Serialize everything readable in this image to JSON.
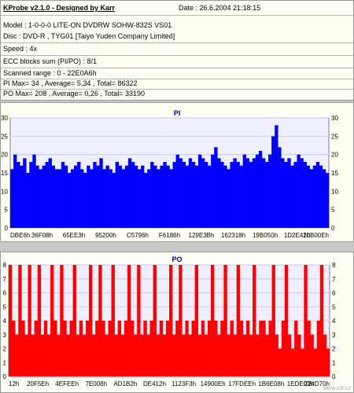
{
  "header": {
    "title": "KProbe v2.1.0 - Designed by Karr",
    "date": "Date : 26.6.2004 21:18:15",
    "model": "Model : 1-0-0-0 LITE-ON DVDRW SOHW-832S  VS01",
    "disc": "Disc : DVD-R , TYG01 [Taiyo Yuden Company Limited]",
    "speed": "Speed : 4x",
    "ecc": "ECC blocks sum (PI/PO) : 8/1",
    "range": "Scanned range : 0 - 22E0A6h",
    "pi_stats": "PI Max= 34 , Average= 5,34 , Total= 86322",
    "po_stats": "PO Max= 208 , Average= 0,26 , Total= 33190"
  },
  "watermark": "www.cdr.cz",
  "colors": {
    "pi": "#0000ff",
    "po": "#ff0000",
    "plot_bg": "#eef0ff",
    "grid": "#c8c8ff"
  },
  "chart_data": [
    {
      "type": "bar",
      "title": "PI",
      "ylim": [
        0,
        30
      ],
      "yticks": [
        "0",
        "5",
        "10",
        "15",
        "20",
        "25",
        "30"
      ],
      "xtick_labels": [
        "DBE6h",
        "36F08h",
        "65EE3h",
        "95200h",
        "C5796h",
        "F6186h",
        "129E3Bh",
        "162318h",
        "19B050h",
        "1D2E41h",
        "20B00Eh"
      ],
      "grid": true,
      "series": [
        {
          "values": [
            16,
            20,
            18,
            17,
            19,
            15,
            18,
            20,
            17,
            16,
            17,
            18,
            19,
            17,
            16,
            16,
            18,
            17,
            15,
            16,
            17,
            18,
            16,
            15,
            17,
            16,
            18,
            17,
            19,
            16,
            17,
            16,
            15,
            18,
            17,
            16,
            17,
            19,
            18,
            17,
            16,
            17,
            15,
            16,
            18,
            17,
            16,
            17,
            18,
            17,
            16,
            18,
            20,
            19,
            18,
            17,
            19,
            18,
            17,
            20,
            19,
            18,
            17,
            20,
            22,
            19,
            18,
            17,
            16,
            18,
            19,
            18,
            17,
            20,
            19,
            18,
            19,
            20,
            21,
            19,
            18,
            20,
            25,
            28,
            22,
            19,
            18,
            19,
            17,
            18,
            20,
            19,
            18,
            17,
            16,
            17,
            18,
            17,
            16,
            15
          ]
        }
      ]
    },
    {
      "type": "bar",
      "title": "PO",
      "ylim": [
        0,
        8
      ],
      "yticks": [
        "0",
        "1",
        "2",
        "3",
        "4",
        "5",
        "6",
        "7",
        "8"
      ],
      "xtick_labels": [
        "12h",
        "20F5Eh",
        "4EFEEh",
        "7E008h",
        "AD1B2h",
        "DE412h",
        "1123F3h",
        "14900Eh",
        "17FDEEh",
        "1B6E08h",
        "1EDE03h",
        "224D70h"
      ],
      "grid": true,
      "series": [
        {
          "values": [
            8,
            4,
            3,
            8,
            4,
            3,
            8,
            3,
            4,
            8,
            3,
            4,
            3,
            8,
            4,
            3,
            8,
            4,
            3,
            4,
            8,
            3,
            4,
            3,
            4,
            8,
            3,
            4,
            8,
            4,
            3,
            4,
            8,
            3,
            4,
            3,
            4,
            8,
            4,
            3,
            8,
            3,
            4,
            3,
            4,
            8,
            3,
            4,
            3,
            4,
            8,
            3,
            4,
            8,
            3,
            4,
            3,
            4,
            8,
            3,
            4,
            3,
            4,
            8,
            4,
            3,
            4,
            8,
            3,
            4,
            3,
            8,
            4,
            3,
            4,
            3,
            8,
            3,
            4,
            4,
            3,
            4,
            8,
            3,
            2,
            4,
            8,
            3,
            2,
            4,
            3,
            2,
            8,
            4,
            3,
            2,
            4,
            8,
            3,
            2
          ]
        }
      ]
    }
  ]
}
